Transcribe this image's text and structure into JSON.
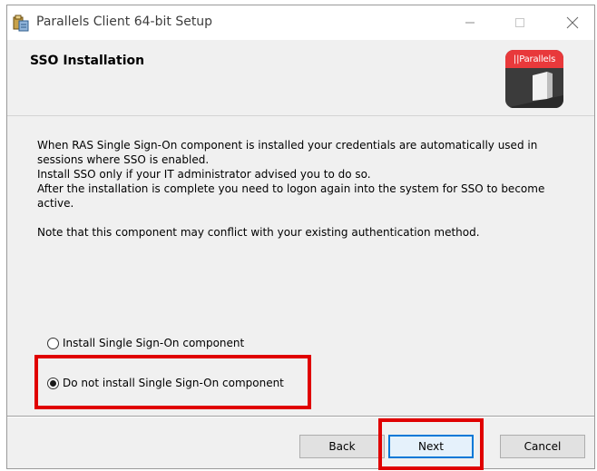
{
  "window": {
    "title": "Parallels Client 64-bit Setup"
  },
  "header": {
    "title": "SSO Installation",
    "logo_text": "||Parallels"
  },
  "description": {
    "line1": "When RAS Single Sign-On component is installed your credentials are automatically used in sessions where SSO is enabled.",
    "line2": "Install SSO only if your IT administrator advised you to do so.",
    "line3": "After the installation is complete you need to logon again into the system for SSO to become active.",
    "note": "Note that this component may conflict with your existing authentication method."
  },
  "options": {
    "install": {
      "label": "Install Single Sign-On component",
      "selected": false
    },
    "do_not_install": {
      "label": "Do not install Single Sign-On component",
      "selected": true
    }
  },
  "buttons": {
    "back": "Back",
    "next": "Next",
    "cancel": "Cancel"
  },
  "colors": {
    "highlight": "#e00000",
    "logo_red": "#e8393b",
    "logo_dark": "#3b3b3b",
    "default_button_border": "#0078d7"
  }
}
